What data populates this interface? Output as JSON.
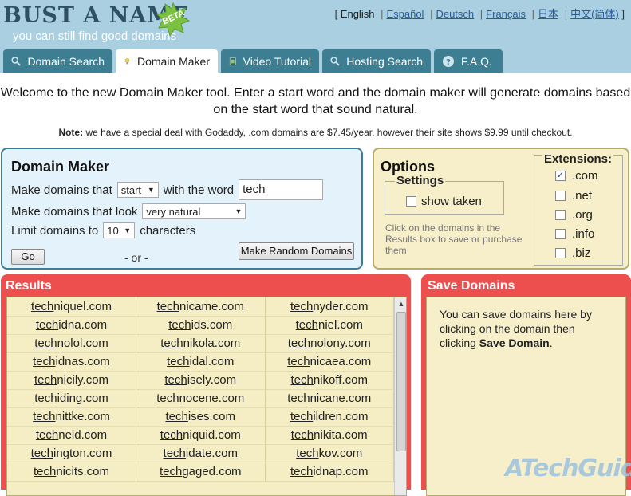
{
  "header": {
    "logo_title": "BUST A NAME",
    "logo_tagline": "you can still find good domains",
    "beta_badge": "BETA",
    "languages": [
      "English",
      "Español",
      "Deutsch",
      "Français",
      "日本",
      "中文(简体)"
    ],
    "tabs": [
      {
        "label": "Domain Search",
        "icon": "magnifier-icon"
      },
      {
        "label": "Domain Maker",
        "icon": "lightbulb-icon"
      },
      {
        "label": "Video Tutorial",
        "icon": "film-icon"
      },
      {
        "label": "Hosting Search",
        "icon": "magnifier-icon"
      },
      {
        "label": "F.A.Q.",
        "icon": "help-icon"
      }
    ],
    "active_tab": "Domain Maker"
  },
  "intro": {
    "text": "Welcome to the new Domain Maker tool. Enter a start word and the domain maker will generate domains based on the start word that sound natural.",
    "note_label": "Note:",
    "note_text": " we have a special deal with Godaddy, .com domains are $7.45/year, however their site shows $9.99 until checkout."
  },
  "maker": {
    "title": "Domain Maker",
    "row1_prefix": "Make domains that",
    "position_select": "start",
    "row1_middle": "with the word",
    "word_value": "tech",
    "row2_prefix": "Make domains that look",
    "style_select": "very natural",
    "row3_prefix": "Limit domains to",
    "limit_select": "10",
    "row3_suffix": "characters",
    "go_label": "Go",
    "or_label": "- or -",
    "random_label": "Make Random Domains"
  },
  "options": {
    "title": "Options",
    "settings_legend": "Settings",
    "show_taken_label": "show taken",
    "show_taken_checked": false,
    "hint": "Click on the domains in the Results box to save or purchase them",
    "extensions_legend": "Extensions:",
    "extensions": [
      {
        "label": ".com",
        "checked": true
      },
      {
        "label": ".net",
        "checked": false
      },
      {
        "label": ".org",
        "checked": false
      },
      {
        "label": ".info",
        "checked": false
      },
      {
        "label": ".biz",
        "checked": false
      }
    ]
  },
  "results": {
    "title": "Results",
    "rows": [
      [
        {
          "prefix": "tech",
          "rest": "niquel.com"
        },
        {
          "prefix": "tech",
          "rest": "nicame.com"
        },
        {
          "prefix": "tech",
          "rest": "nyder.com"
        }
      ],
      [
        {
          "prefix": "tech",
          "rest": "idna.com"
        },
        {
          "prefix": "tech",
          "rest": "ids.com"
        },
        {
          "prefix": "tech",
          "rest": "niel.com"
        }
      ],
      [
        {
          "prefix": "tech",
          "rest": "nolol.com"
        },
        {
          "prefix": "tech",
          "rest": "nikola.com"
        },
        {
          "prefix": "tech",
          "rest": "nolony.com"
        }
      ],
      [
        {
          "prefix": "tech",
          "rest": "idnas.com"
        },
        {
          "prefix": "tech",
          "rest": "idal.com"
        },
        {
          "prefix": "tech",
          "rest": "nicaea.com"
        }
      ],
      [
        {
          "prefix": "tech",
          "rest": "nicily.com"
        },
        {
          "prefix": "tech",
          "rest": "isely.com"
        },
        {
          "prefix": "tech",
          "rest": "nikoff.com"
        }
      ],
      [
        {
          "prefix": "tech",
          "rest": "iding.com"
        },
        {
          "prefix": "tech",
          "rest": "nocene.com"
        },
        {
          "prefix": "tech",
          "rest": "nicane.com"
        }
      ],
      [
        {
          "prefix": "tech",
          "rest": "nittke.com"
        },
        {
          "prefix": "tech",
          "rest": "ises.com"
        },
        {
          "prefix": "tech",
          "rest": "ildren.com"
        }
      ],
      [
        {
          "prefix": "tech",
          "rest": "neid.com"
        },
        {
          "prefix": "tech",
          "rest": "niquid.com"
        },
        {
          "prefix": "tech",
          "rest": "nikita.com"
        }
      ],
      [
        {
          "prefix": "tech",
          "rest": "ington.com"
        },
        {
          "prefix": "tech",
          "rest": "idate.com"
        },
        {
          "prefix": "tech",
          "rest": "kov.com"
        }
      ],
      [
        {
          "prefix": "tech",
          "rest": "nicits.com"
        },
        {
          "prefix": "tech",
          "rest": "gaged.com"
        },
        {
          "prefix": "tech",
          "rest": "idnap.com"
        }
      ]
    ]
  },
  "save": {
    "title": "Save Domains",
    "text_before": "You can save domains here by clicking on the domain then clicking ",
    "text_bold": "Save Domain",
    "text_after": "."
  },
  "watermark": "ATechGuide",
  "colors": {
    "header_bg": "#a9cfe0",
    "tab_bg": "#3d7e93",
    "results_red": "#ed4f4f",
    "options_bg": "#f7efc9",
    "maker_bg": "#e4f3fb"
  }
}
